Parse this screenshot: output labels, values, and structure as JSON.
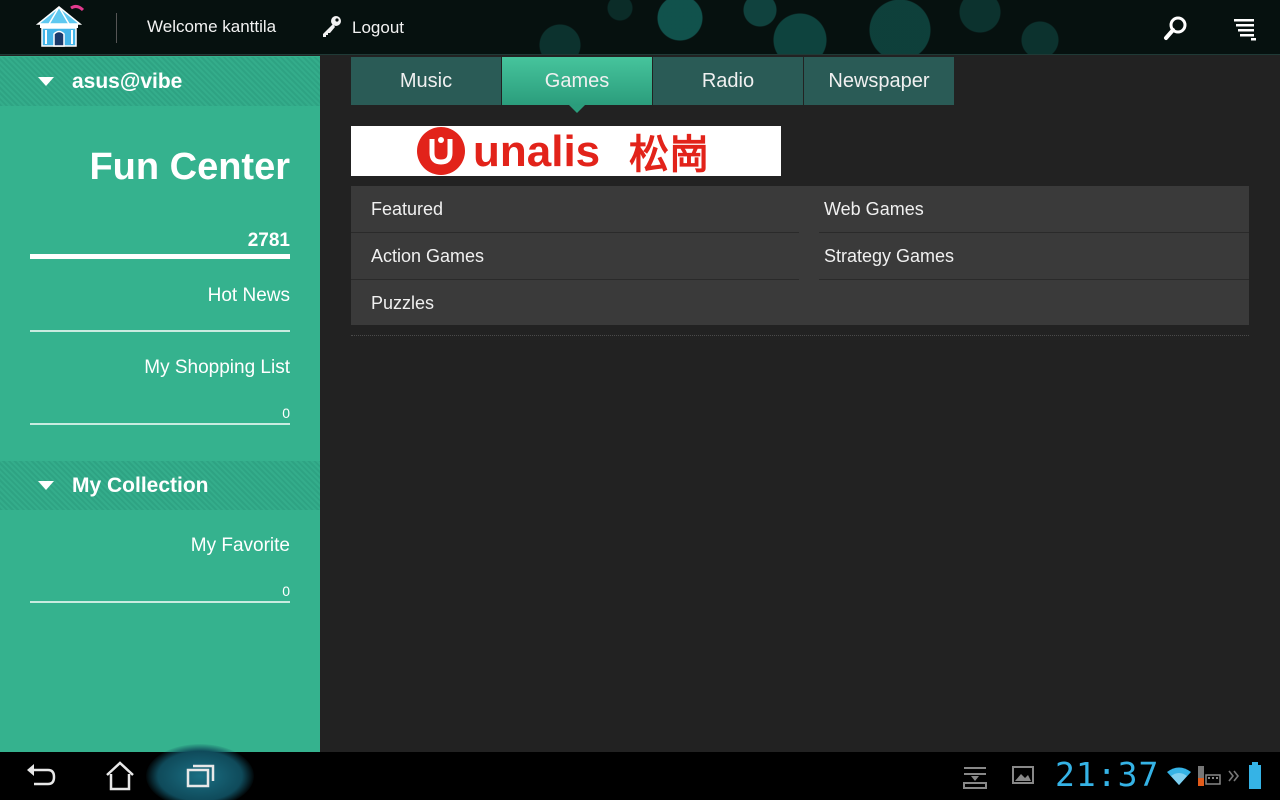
{
  "topbar": {
    "welcome": "Welcome kanttila",
    "logout_label": "Logout",
    "icons": [
      "fun-center-logo-icon",
      "key-icon",
      "search-icon",
      "menu-list-icon"
    ]
  },
  "sidebar": {
    "account_header": "asus@vibe",
    "title": "Fun Center",
    "total_count": "2781",
    "hot_news": "Hot News",
    "shopping_list": "My Shopping List",
    "shopping_count": "0",
    "collection_header": "My Collection",
    "my_favorite": "My Favorite",
    "favorite_count": "0"
  },
  "tabs": [
    {
      "label": "Music"
    },
    {
      "label": "Games",
      "active": true
    },
    {
      "label": "Radio"
    },
    {
      "label": "Newspaper"
    }
  ],
  "banner": {
    "brand": "unalis",
    "brand_cjk": "松崗"
  },
  "categories": [
    {
      "label": "Featured"
    },
    {
      "label": "Web Games"
    },
    {
      "label": "Action Games"
    },
    {
      "label": "Strategy Games"
    },
    {
      "label": "Puzzles"
    }
  ],
  "status": {
    "clock": "21:37",
    "icons": [
      "back-icon",
      "home-icon",
      "recent-apps-icon",
      "download-icon",
      "gallery-icon",
      "wifi-icon",
      "keyboard-icon",
      "battery-icon"
    ]
  },
  "colors": {
    "accent_green": "#35b28e",
    "tab_dark": "#2a5b56",
    "clock_blue": "#35b3e6",
    "banner_red": "#e2231a"
  }
}
